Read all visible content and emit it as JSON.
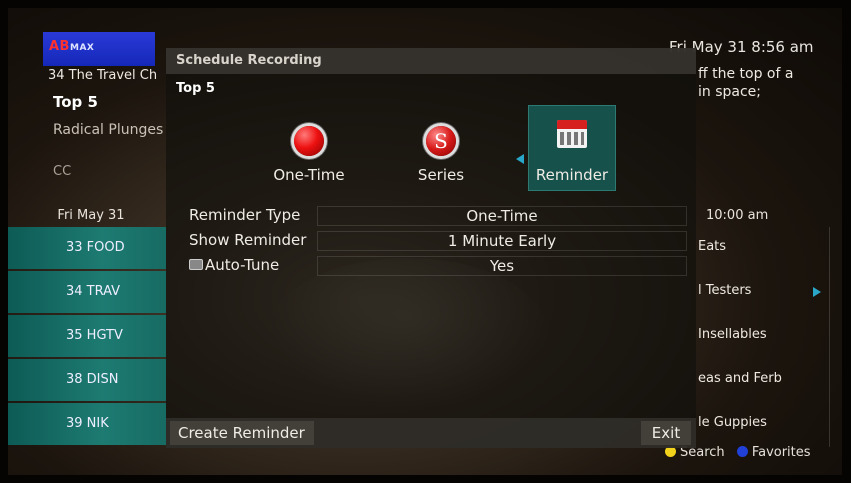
{
  "header": {
    "logo_text_main": "AB",
    "logo_text_sub": "MAX",
    "datetime": "Fri  May 31 8:56 am"
  },
  "info": {
    "channel": "34 The Travel Ch",
    "title": "Top 5",
    "episode": "Radical Plunges",
    "cc": "CC",
    "description_line1": "ff the top of a",
    "description_line2": "in space;"
  },
  "guide": {
    "date": "Fri May 31",
    "time": "10:00 am",
    "channels": [
      "33 FOOD",
      "34 TRAV",
      "35 HGTV",
      "38 DISN",
      "39 NIK"
    ],
    "programs": [
      "Eats",
      "l Testers",
      "Insellables",
      "eas and Ferb",
      "le Guppies"
    ]
  },
  "dialog": {
    "title": "Schedule Recording",
    "subtitle": "Top 5",
    "options": [
      {
        "label": "One-Time",
        "icon": "record-icon"
      },
      {
        "label": "Series",
        "icon": "series-icon",
        "glyph": "S"
      },
      {
        "label": "Reminder",
        "icon": "calendar-icon"
      }
    ],
    "settings": [
      {
        "key": "Reminder Type",
        "value": "One-Time"
      },
      {
        "key": "Show Reminder",
        "value": "1 Minute Early"
      },
      {
        "key": "Auto-Tune",
        "value": "Yes"
      }
    ],
    "create_label": "Create Reminder",
    "exit_label": "Exit"
  },
  "legend": {
    "search_label": "Search",
    "favorites_label": "Favorites"
  },
  "colors": {
    "accent": "#2aa7c8",
    "channel_bar": "#1d7b72",
    "selected_option": "#16514c"
  }
}
